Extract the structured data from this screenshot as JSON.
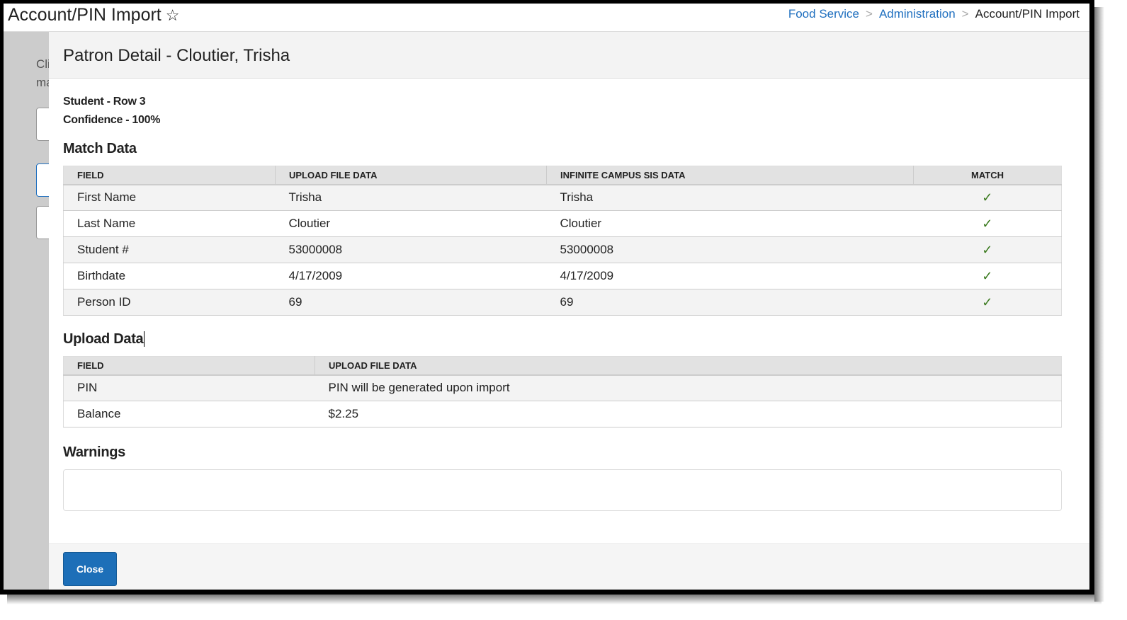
{
  "app": {
    "title": "Account/PIN Import",
    "favorite_icon": "star-outline-icon"
  },
  "breadcrumb": [
    "Food Service",
    "Administration",
    "Account/PIN Import"
  ],
  "background": {
    "text1": "Cli",
    "text2": "ma"
  },
  "modal": {
    "title": "Patron Detail - Cloutier, Trisha",
    "row_info": "Student - Row 3",
    "confidence": "Confidence - 100%",
    "match_section": "Match Data",
    "match_headers": [
      "FIELD",
      "UPLOAD FILE DATA",
      "INFINITE CAMPUS SIS DATA",
      "MATCH"
    ],
    "match_rows": [
      {
        "field": "First Name",
        "upload": "Trisha",
        "sis": "Trisha",
        "match": "✓"
      },
      {
        "field": "Last Name",
        "upload": "Cloutier",
        "sis": "Cloutier",
        "match": "✓"
      },
      {
        "field": "Student #",
        "upload": "53000008",
        "sis": "53000008",
        "match": "✓"
      },
      {
        "field": "Birthdate",
        "upload": "4/17/2009",
        "sis": "4/17/2009",
        "match": "✓"
      },
      {
        "field": "Person ID",
        "upload": "69",
        "sis": "69",
        "match": "✓"
      }
    ],
    "upload_section": "Upload Data",
    "upload_headers": [
      "FIELD",
      "UPLOAD FILE DATA"
    ],
    "upload_rows": [
      {
        "field": "PIN",
        "value": "PIN will be generated upon import"
      },
      {
        "field": "Balance",
        "value": "$2.25"
      }
    ],
    "warnings_section": "Warnings",
    "close_label": "Close"
  },
  "colors": {
    "accent": "#1d6fb8",
    "link": "#1f6fbf",
    "match_check": "#3a7a1e"
  }
}
